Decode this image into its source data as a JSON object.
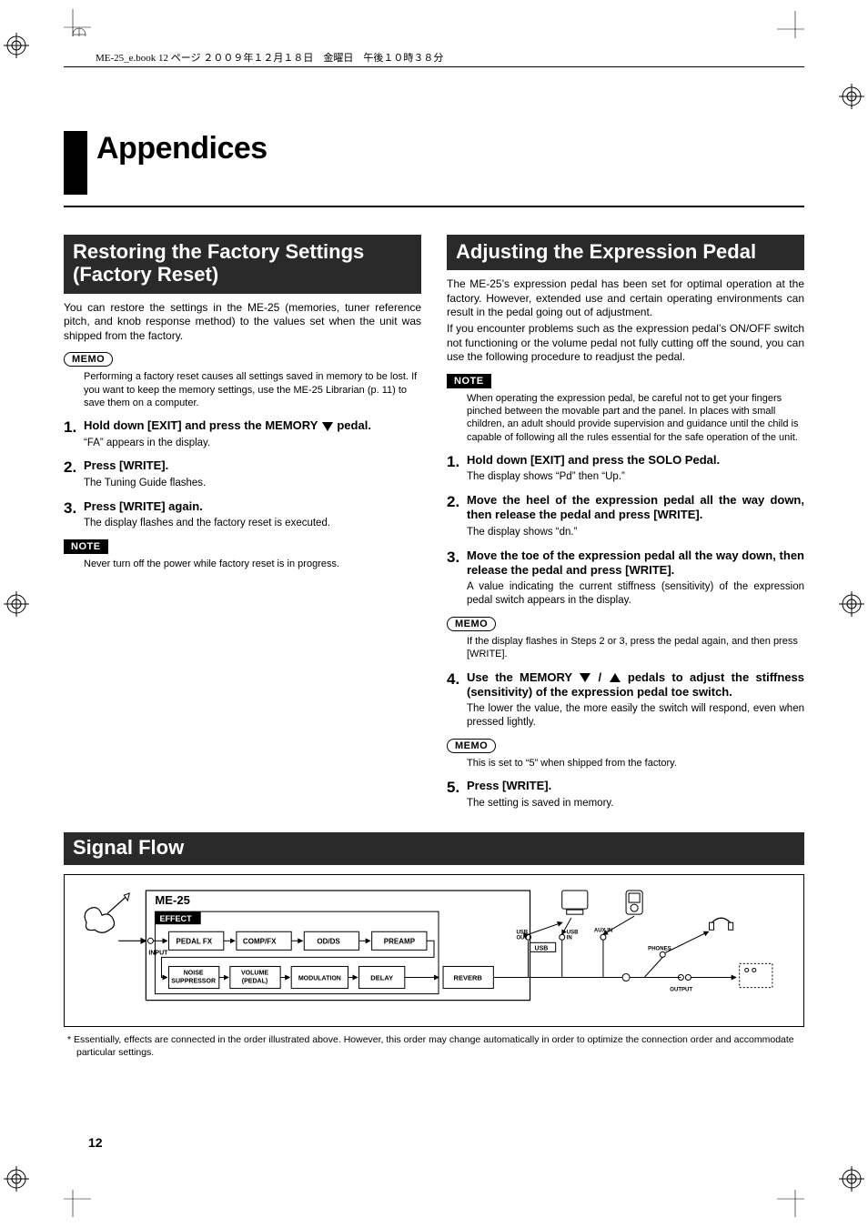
{
  "running_head": "ME-25_e.book  12 ページ  ２００９年１２月１８日　金曜日　午後１０時３８分",
  "chapter_title": "Appendices",
  "left": {
    "heading": "Restoring the Factory Settings (Factory Reset)",
    "intro": "You can restore the settings in the ME-25 (memories, tuner reference pitch, and knob response method) to the values set when the unit was shipped from the factory.",
    "memo_label": "MEMO",
    "memo": "Performing a factory reset causes all settings saved in memory to be lost. If you want to keep the memory settings, use the ME-25 Librarian (p. 11) to save them on a computer.",
    "steps": [
      {
        "num": "1.",
        "inst_pre": "Hold down [EXIT] and press the MEMORY ",
        "inst_post": " pedal.",
        "sub": "“FA” appears in the display."
      },
      {
        "num": "2.",
        "inst": "Press [WRITE].",
        "sub": "The Tuning Guide flashes."
      },
      {
        "num": "3.",
        "inst": "Press [WRITE] again.",
        "sub": "The display flashes and the factory reset is executed."
      }
    ],
    "note_label": "NOTE",
    "note": "Never turn off the power while factory reset is in progress."
  },
  "right": {
    "heading": "Adjusting the Expression Pedal",
    "intro1": "The ME-25’s expression pedal has been set for optimal operation at the factory. However, extended use and certain operating environments can result in the pedal going out of adjustment.",
    "intro2": "If you encounter problems such as the expression pedal’s ON/OFF switch not functioning or the volume pedal not fully cutting off the sound, you can use the following procedure to readjust the pedal.",
    "note_label": "NOTE",
    "note": "When operating the expression pedal, be careful not to get your fingers pinched between the movable part and the panel. In places with small children, an adult should provide supervision and guidance until the child is capable of following all the rules essential for the safe operation of the unit.",
    "steps": [
      {
        "num": "1.",
        "inst": "Hold down [EXIT] and press the SOLO Pedal.",
        "sub": "The display shows “Pd” then “Up.”"
      },
      {
        "num": "2.",
        "inst": "Move the heel of the expression pedal all the way down, then release the pedal and press [WRITE].",
        "sub": "The display shows “dn.”"
      },
      {
        "num": "3.",
        "inst": "Move the toe of the expression pedal all the way down, then release the pedal and press [WRITE].",
        "sub": "A value indicating the current stiffness (sensitivity) of the expression pedal switch appears in the display."
      }
    ],
    "memo1_label": "MEMO",
    "memo1": "If the display flashes in Steps 2 or 3, press the pedal again, and then press [WRITE].",
    "step4": {
      "num": "4.",
      "inst_pre": "Use the MEMORY ",
      "inst_mid": " / ",
      "inst_post": " pedals to adjust the stiffness (sensitivity) of the expression pedal toe switch.",
      "sub": "The lower the value, the more easily the switch will respond, even when pressed lightly."
    },
    "memo2_label": "MEMO",
    "memo2": "This is set to “5” when shipped from the factory.",
    "step5": {
      "num": "5.",
      "inst": "Press [WRITE].",
      "sub": "The setting is saved in memory."
    }
  },
  "signal_flow": {
    "heading": "Signal Flow",
    "device": "ME-25",
    "effect_label": "EFFECT",
    "row1": [
      "PEDAL FX",
      "COMP/FX",
      "OD/DS",
      "PREAMP"
    ],
    "row2": [
      "NOISE SUPPRESSOR",
      "VOLUME (PEDAL)",
      "MODULATION",
      "DELAY",
      "REVERB"
    ],
    "io": {
      "input": "INPUT",
      "usb_out": "USB OUT",
      "usb_in": "USB IN",
      "usb": "USB",
      "aux_in": "AUX IN",
      "phones": "PHONES",
      "output": "OUTPUT"
    },
    "footnote": "*   Essentially, effects are connected in the order illustrated above. However, this order may change automatically in order to optimize the connection order and accommodate particular settings."
  },
  "page_number": "12"
}
